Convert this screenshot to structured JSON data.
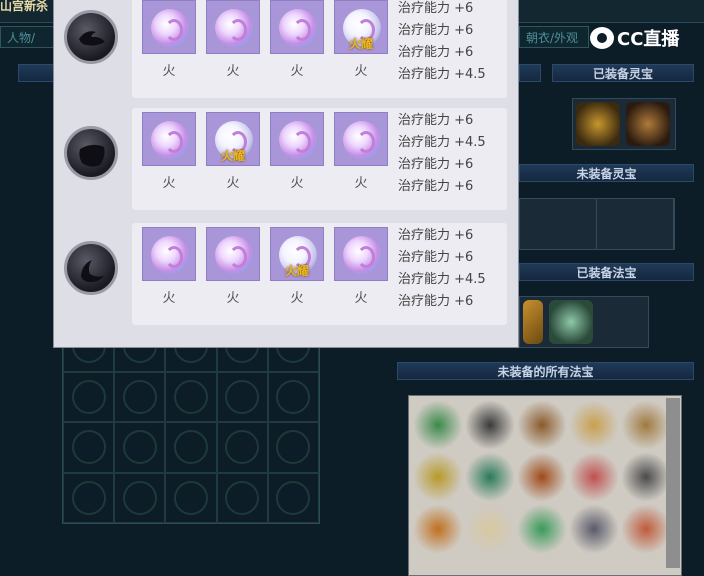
{
  "background": {
    "title": "山宫新杀",
    "tabs": [
      "人物/",
      "朝衣/外观"
    ],
    "section_equipped_spirit": "已装备灵宝",
    "section_unequipped_spirit": "未装备灵宝",
    "section_equipped_magic": "已装备法宝",
    "section_all_unequipped_magic": "未装备的所有法宝"
  },
  "logo": {
    "text": "CC直播"
  },
  "popup": {
    "groups": [
      {
        "icon": "moon-stone-icon",
        "stones": [
          {
            "label": "火",
            "badge": ""
          },
          {
            "label": "火",
            "badge": ""
          },
          {
            "label": "火",
            "badge": ""
          },
          {
            "label": "火",
            "badge": "火耀"
          }
        ],
        "stats": [
          "治疗能力 +6",
          "治疗能力 +6",
          "治疗能力 +6",
          "治疗能力 +4.5"
        ]
      },
      {
        "icon": "shield-stone-icon",
        "stones": [
          {
            "label": "火",
            "badge": ""
          },
          {
            "label": "火",
            "badge": "火耀"
          },
          {
            "label": "火",
            "badge": ""
          },
          {
            "label": "火",
            "badge": ""
          }
        ],
        "stats": [
          "治疗能力 +6",
          "治疗能力 +4.5",
          "治疗能力 +6",
          "治疗能力 +6"
        ]
      },
      {
        "icon": "crescent-stone-icon",
        "stones": [
          {
            "label": "火",
            "badge": ""
          },
          {
            "label": "火",
            "badge": ""
          },
          {
            "label": "火",
            "badge": "火耀"
          },
          {
            "label": "火",
            "badge": ""
          }
        ],
        "stats": [
          "治疗能力 +6",
          "治疗能力 +6",
          "治疗能力 +4.5",
          "治疗能力 +6"
        ]
      }
    ]
  }
}
